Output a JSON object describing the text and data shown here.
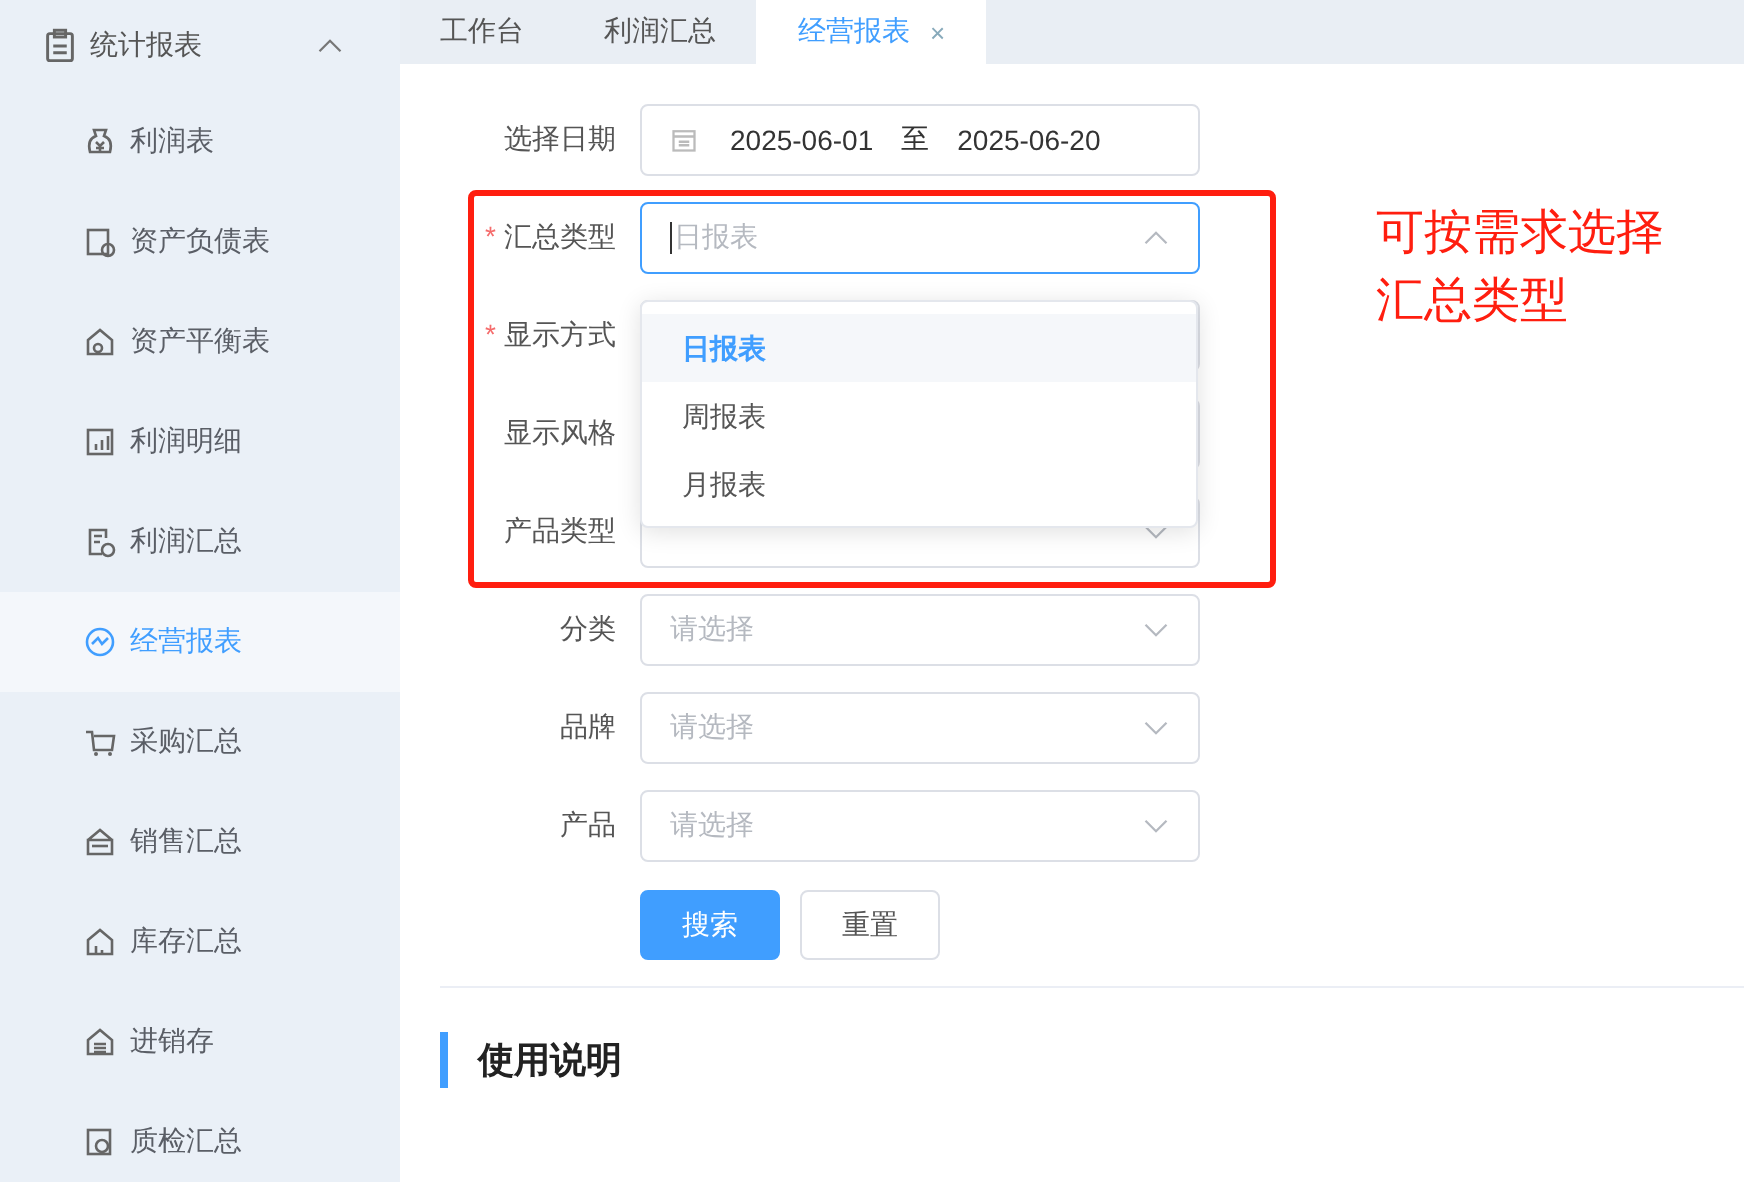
{
  "sidebar": {
    "group": {
      "label": "统计报表",
      "expanded": true
    },
    "items": [
      {
        "label": "利润表",
        "selected": false
      },
      {
        "label": "资产负债表",
        "selected": false
      },
      {
        "label": "资产平衡表",
        "selected": false
      },
      {
        "label": "利润明细",
        "selected": false
      },
      {
        "label": "利润汇总",
        "selected": false
      },
      {
        "label": "经营报表",
        "selected": true
      },
      {
        "label": "采购汇总",
        "selected": false
      },
      {
        "label": "销售汇总",
        "selected": false
      },
      {
        "label": "库存汇总",
        "selected": false
      },
      {
        "label": "进销存",
        "selected": false
      },
      {
        "label": "质检汇总",
        "selected": false
      }
    ]
  },
  "tabs": [
    {
      "label": "工作台",
      "selected": false,
      "closable": false
    },
    {
      "label": "利润汇总",
      "selected": false,
      "closable": false
    },
    {
      "label": "经营报表",
      "selected": true,
      "closable": true,
      "close": "×"
    }
  ],
  "form": {
    "required_mark": "*",
    "fields": [
      {
        "kind": "date_range",
        "label": "选择日期",
        "required": false,
        "start": "2025-06-01",
        "separator": "至",
        "end": "2025-06-20"
      },
      {
        "kind": "select",
        "label": "汇总类型",
        "required": true,
        "placeholder": "日报表",
        "focused": true
      },
      {
        "kind": "covered",
        "label": "显示方式",
        "required": true
      },
      {
        "kind": "covered",
        "label": "显示风格",
        "required": false
      },
      {
        "kind": "select",
        "label": "产品类型",
        "required": false,
        "focused": false
      },
      {
        "kind": "select",
        "label": "分类",
        "required": false,
        "placeholder": "请选择",
        "focused": false
      },
      {
        "kind": "select",
        "label": "品牌",
        "required": false,
        "placeholder": "请选择",
        "focused": false
      },
      {
        "kind": "select",
        "label": "产品",
        "required": false,
        "placeholder": "请选择",
        "focused": false
      }
    ],
    "dropdown": {
      "options": [
        {
          "label": "日报表",
          "selected": true
        },
        {
          "label": "周报表",
          "selected": false
        },
        {
          "label": "月报表",
          "selected": false
        }
      ]
    },
    "buttons": [
      {
        "label": "搜索",
        "kind": "primary"
      },
      {
        "label": "重置",
        "kind": "default"
      }
    ]
  },
  "section_title": "使用说明",
  "annotation": {
    "text": "可按需求选择汇总类型"
  }
}
